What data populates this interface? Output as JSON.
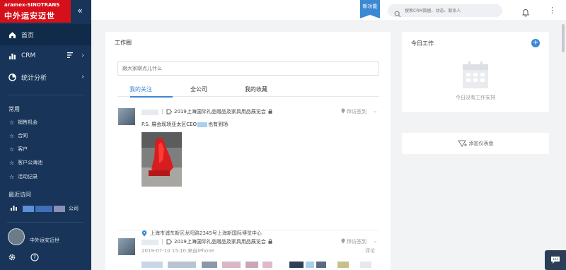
{
  "logo": {
    "top_text": "aramex-SINOTRANS",
    "bottom_text": "中外运安迈世"
  },
  "sidebar": {
    "collapse_icon": "double-chevron-left-icon",
    "nav": [
      {
        "label": "首页",
        "icon": "home-icon",
        "active": true
      },
      {
        "label": "CRM",
        "icon": "bar-chart-icon",
        "extra_icon": "list-filter-icon",
        "arrow": "›"
      },
      {
        "label": "统计分析",
        "icon": "pie-chart-icon",
        "arrow": "›"
      }
    ],
    "common_title": "常用",
    "common_items": [
      "销售机会",
      "合同",
      "客户",
      "客户公海池",
      "活动记录"
    ],
    "recent_title": "最近访问",
    "recent_item_suffix": "公司",
    "user_name": "中外运安迈世",
    "footer_icons": [
      "gear-icon",
      "help-icon"
    ]
  },
  "topbar": {
    "new_feature_label": "新功能",
    "search_placeholder": "搜索CRM数据、动态、联系人",
    "bell_icon": "bell-icon",
    "more_icon": "more-vertical-icon"
  },
  "feed": {
    "title": "工作圈",
    "input_placeholder": "跟大家聊点儿什么",
    "tabs": [
      {
        "label": "我的关注",
        "active": true
      },
      {
        "label": "全公司",
        "active": false
      },
      {
        "label": "我的收藏",
        "active": false
      }
    ],
    "posts": [
      {
        "event": "2019上海国际礼品赠品及家具用品展览会",
        "checkin": "拜访签到",
        "text_prefix": "P.S. 展会现场亚太区CEO",
        "text_suffix": "也有到场",
        "location": "上海市浦东新区龙阳路2345号上海新国际博览中心",
        "time": "2019-07-10 15:10 来自iPhone",
        "comment": "评论"
      },
      {
        "event": "2019上海国际礼品赠品及家具用品展览会",
        "checkin": "拜访签到"
      }
    ]
  },
  "today": {
    "title": "今日工作",
    "empty_text": "今日没有工作安排",
    "add_icon": "plus-circle-icon",
    "calendar_icon": "calendar-icon"
  },
  "dashboard": {
    "label": "添加仪表盘",
    "icon": "chart-add-icon"
  },
  "chat_icon": "chat-icon",
  "colors": {
    "sidebar": "#183559",
    "accent": "#3b88d3",
    "brand_red": "#d6101a"
  }
}
